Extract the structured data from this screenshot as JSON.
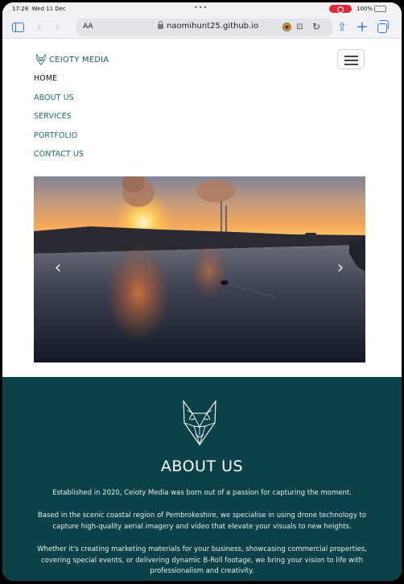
{
  "status_bar": {
    "time": "17:28",
    "date": "Wed 11 Dec",
    "dots": "•••",
    "battery": "100%"
  },
  "browser": {
    "text_size_label": "AA",
    "url": "naomihunt25.github.io",
    "back_glyph": "‹",
    "forward_glyph": "›",
    "reload_glyph": "↻",
    "share_glyph": "⇪",
    "new_tab_glyph": "+",
    "ext_glyph": "⊡"
  },
  "site": {
    "brand_name": "CEIOTY MEDIA",
    "brand_color": "#1d5a5e",
    "nav": [
      {
        "label": "HOME",
        "active": true
      },
      {
        "label": "ABOUT US"
      },
      {
        "label": "SERVICES"
      },
      {
        "label": "PORTFOLIO"
      },
      {
        "label": "CONTACT US"
      }
    ],
    "carousel": {
      "prev_glyph": "‹",
      "next_glyph": "›"
    },
    "about": {
      "background": "#0b4149",
      "title": "ABOUT US",
      "paragraphs": [
        "Established in 2020, Ceioty Media was born out of a passion for capturing the moment.",
        "Based in the scenic coastal region of Pembrokeshire, we specialise in using drone technology to capture high-quality aerial imagery and video that elevate your visuals to new heights.",
        "Whether it's creating marketing materials for your business, showcasing commercial properties, covering special events, or delivering dynamic B-Roll footage, we bring your vision to life with professionalism and creativity."
      ]
    }
  }
}
